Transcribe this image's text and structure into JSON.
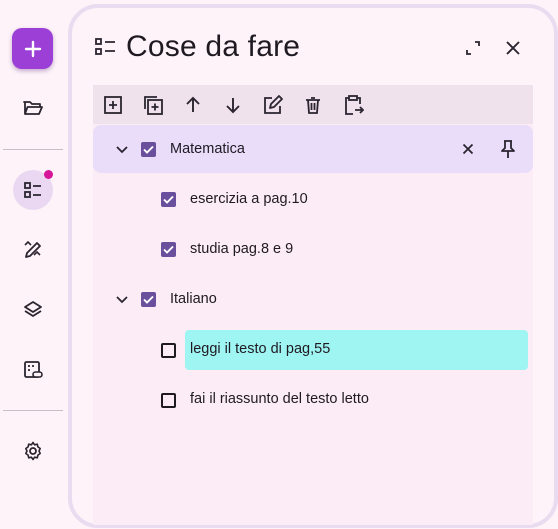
{
  "rail": {
    "fab_icon": "plus-icon",
    "items": [
      {
        "name": "folder-open-icon"
      },
      {
        "name": "checklist-icon",
        "active": true,
        "badge": true
      },
      {
        "name": "pen-ruler-icon"
      },
      {
        "name": "layers-icon"
      },
      {
        "name": "calendar-link-icon"
      },
      {
        "name": "gear-icon"
      }
    ]
  },
  "panel": {
    "title": "Cose da fare",
    "toolbar": [
      "add-box-icon",
      "duplicate-icon",
      "arrow-up-icon",
      "arrow-down-icon",
      "edit-icon",
      "delete-icon",
      "paste-icon"
    ]
  },
  "tasks": [
    {
      "label": "Matematica",
      "checked": true,
      "expanded": true,
      "level": 0,
      "children": [
        {
          "label": "esercizia a pag.10",
          "checked": true
        },
        {
          "label": "studia pag.8 e 9",
          "checked": true
        }
      ]
    },
    {
      "label": "Italiano",
      "checked": true,
      "expanded": true,
      "level": 0,
      "children": [
        {
          "label": "leggi il testo di pag,55",
          "checked": false,
          "highlighted": true
        },
        {
          "label": "fai il riassunto del testo letto",
          "checked": false
        }
      ]
    }
  ],
  "colors": {
    "accent": "#9b3fd6",
    "checkbox": "#6a4f9c",
    "highlight": "#9ff5f2",
    "badge": "#d6159a"
  }
}
